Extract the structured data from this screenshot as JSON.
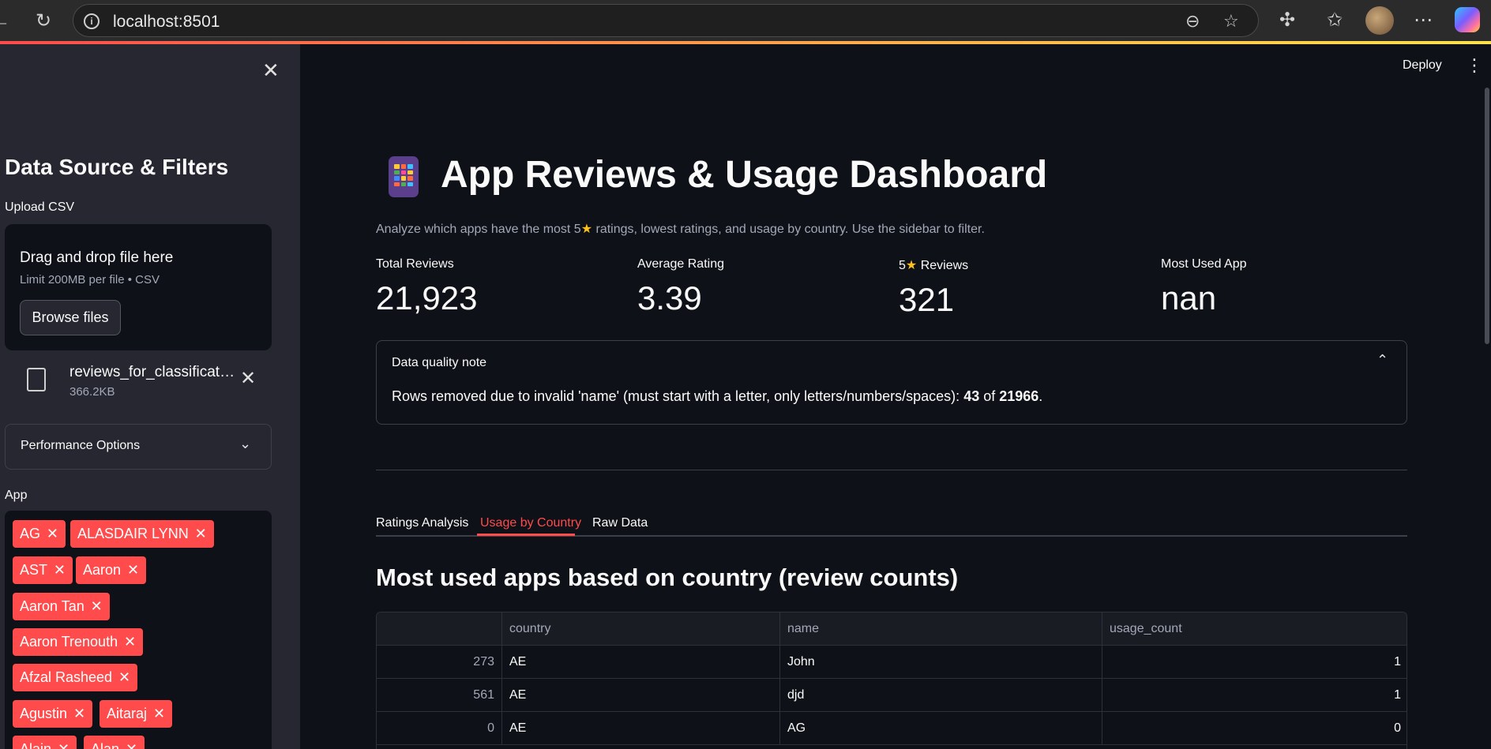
{
  "browser": {
    "url": "localhost:8501"
  },
  "sidebar": {
    "heading": "Data Source & Filters",
    "upload_label": "Upload CSV",
    "dropzone_title": "Drag and drop file here",
    "dropzone_limit": "Limit 200MB per file • CSV",
    "browse_label": "Browse files",
    "file_name": "reviews_for_classification.csv",
    "file_size": "366.2KB",
    "performance_label": "Performance Options",
    "app_label": "App",
    "app_tags": [
      "AG",
      "ALASDAIR LYNN",
      "AST",
      "Aaron",
      "Aaron Tan",
      "Aaron Trenouth",
      "Afzal Rasheed",
      "Agustin",
      "Aitaraj",
      "Alain",
      "Alan"
    ]
  },
  "header": {
    "deploy_label": "Deploy"
  },
  "main": {
    "title": "App Reviews & Usage Dashboard",
    "caption_pre": "Analyze which apps have the most 5",
    "caption_post": " ratings, lowest ratings, and usage by country. Use the sidebar to filter.",
    "metrics": [
      {
        "label": "Total Reviews",
        "value": "21,923"
      },
      {
        "label": "Average Rating",
        "value": "3.39"
      },
      {
        "label_pre": "5",
        "label_post": " Reviews",
        "value": "321"
      },
      {
        "label": "Most Used App",
        "value": "nan"
      }
    ],
    "note": {
      "title": "Data quality note",
      "body_pre": "Rows removed due to invalid 'name' (must start with a letter, only letters/numbers/spaces): ",
      "removed": "43",
      "of": " of ",
      "total": "21966",
      "end": "."
    },
    "tabs": [
      "Ratings Analysis",
      "Usage by Country",
      "Raw Data"
    ],
    "active_tab": "Usage by Country",
    "section_title": "Most used apps based on country (review counts)",
    "table": {
      "columns": [
        "",
        "country",
        "name",
        "usage_count"
      ],
      "rows": [
        [
          "273",
          "AE",
          "John",
          "1"
        ],
        [
          "561",
          "AE",
          "djd",
          "1"
        ],
        [
          "0",
          "AE",
          "AG",
          "0"
        ]
      ]
    }
  },
  "colors": {
    "accent": "#ff4b4b",
    "background": "#0e1117",
    "sidebar": "#262730",
    "star": "#ffc21c"
  },
  "icons": [
    "back-icon",
    "reload-icon",
    "info-icon",
    "zoom-out-icon",
    "star-icon",
    "extensions-icon",
    "favorites-icon",
    "more-icon",
    "close-icon",
    "file-icon",
    "chevron-down-icon",
    "chevron-up-icon",
    "kebab-icon",
    "app-grid-icon"
  ]
}
